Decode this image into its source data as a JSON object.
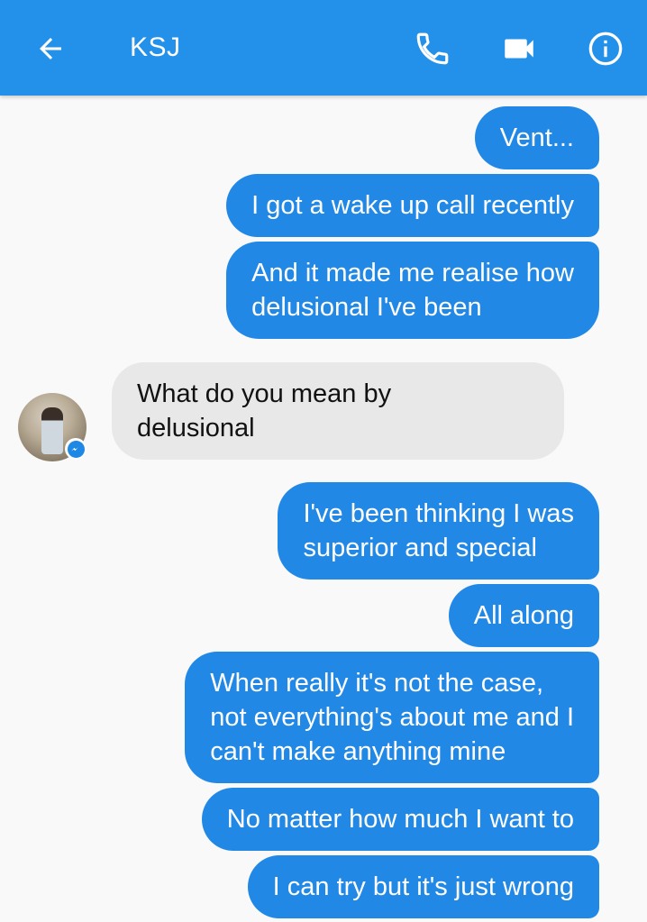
{
  "header": {
    "title": "KSJ",
    "back_icon": "arrow-left-icon",
    "call_icon": "phone-icon",
    "video_icon": "video-camera-icon",
    "info_icon": "info-icon",
    "bg_color": "#2390ea"
  },
  "conversation": {
    "outgoing_color": "#2188e6",
    "incoming_color": "#e8e8e8",
    "messages": [
      {
        "direction": "out",
        "text": "Vent..."
      },
      {
        "direction": "out",
        "text": "I got a wake up call recently"
      },
      {
        "direction": "out",
        "text": "And it made me realise how\ndelusional I've been"
      },
      {
        "direction": "in",
        "text": "What do you mean by\ndelusional"
      },
      {
        "direction": "out",
        "text": "I've been thinking I was\nsuperior and special"
      },
      {
        "direction": "out",
        "text": "All along"
      },
      {
        "direction": "out",
        "text": "When really it's not the case,\nnot everything's about me and I\ncan't make anything mine"
      },
      {
        "direction": "out",
        "text": "No matter how much I want to"
      },
      {
        "direction": "out",
        "text": "I can try but it's just wrong"
      }
    ]
  }
}
